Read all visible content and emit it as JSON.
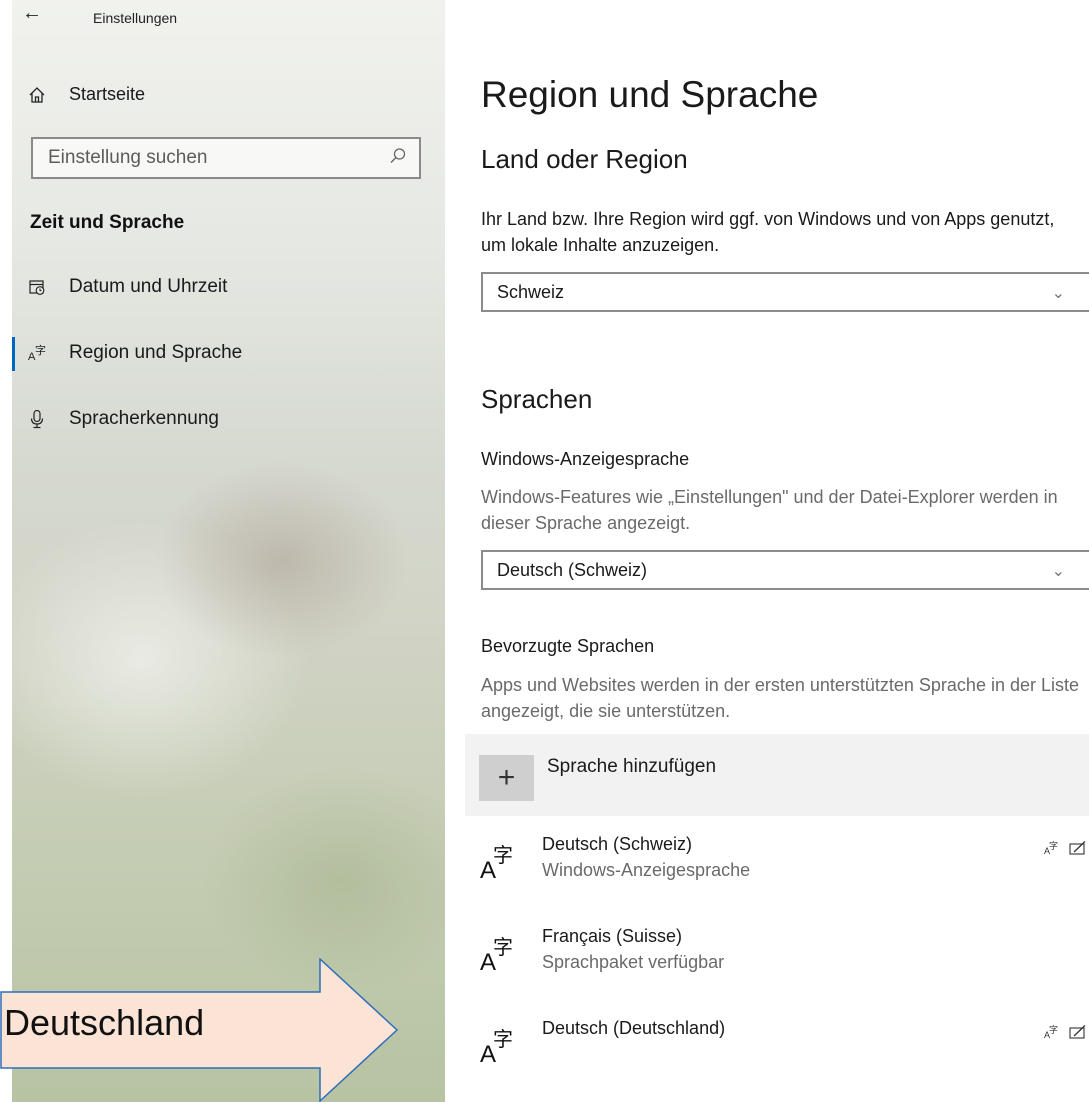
{
  "window": {
    "title": "Einstellungen"
  },
  "sidebar": {
    "home_label": "Startseite",
    "search_placeholder": "Einstellung suchen",
    "section_header": "Zeit und Sprache",
    "items": [
      {
        "label": "Datum und Uhrzeit",
        "icon": "calendar-clock-icon",
        "selected": false
      },
      {
        "label": "Region und Sprache",
        "icon": "language-icon",
        "selected": true
      },
      {
        "label": "Spracherkennung",
        "icon": "microphone-icon",
        "selected": false
      }
    ]
  },
  "main": {
    "page_title": "Region und Sprache",
    "country": {
      "heading": "Land oder Region",
      "description": "Ihr Land bzw. Ihre Region wird ggf. von Windows und von Apps genutzt, um lokale Inhalte anzuzeigen.",
      "selected": "Schweiz"
    },
    "languages": {
      "heading": "Sprachen",
      "display_language": {
        "label": "Windows-Anzeigesprache",
        "description": "Windows-Features wie „Einstellungen\" und der Datei-Explorer werden in dieser Sprache angezeigt.",
        "selected": "Deutsch (Schweiz)"
      },
      "preferred": {
        "label": "Bevorzugte Sprachen",
        "description": "Apps und Websites werden in der ersten unterstützten Sprache in der Liste angezeigt, die sie unterstützen.",
        "add_label": "Sprache hinzufügen",
        "items": [
          {
            "name": "Deutsch (Schweiz)",
            "status": "Windows-Anzeigesprache",
            "features": true
          },
          {
            "name": "Français (Suisse)",
            "status": "Sprachpaket verfügbar",
            "features": false
          },
          {
            "name": "Deutsch (Deutschland)",
            "status": "",
            "features": true
          }
        ]
      }
    }
  },
  "annotation": {
    "arrow_label": "Deutschland",
    "arrow_fill": "#fbe3d6",
    "arrow_stroke": "#2f6fba"
  },
  "colors": {
    "accent": "#0067c0",
    "add_button_bg": "#cfcfcf"
  }
}
